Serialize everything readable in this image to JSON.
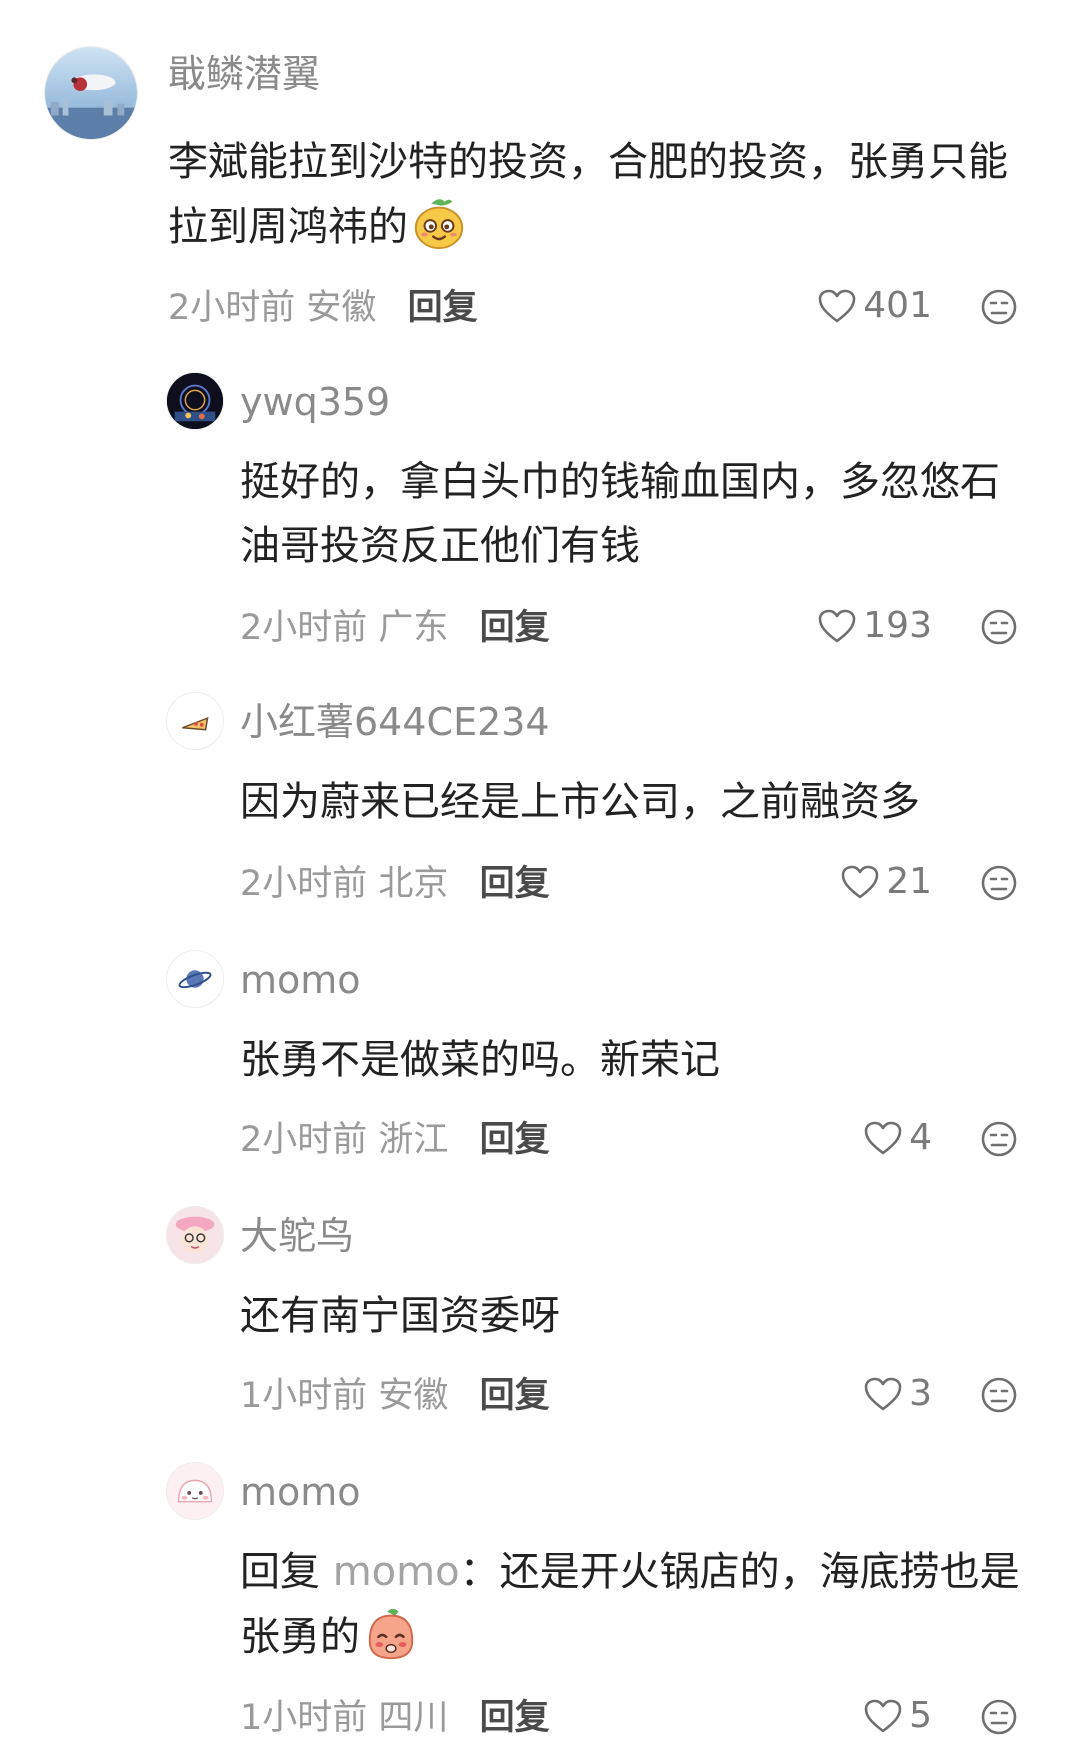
{
  "comments": [
    {
      "username": "戢鳞潜翼",
      "text_before_emoji": "李斌能拉到沙特的投资，合肥的投资，张勇只能拉到周鸿祎的",
      "emoji": "smirk-sticker",
      "time": "2小时前",
      "location": "安徽",
      "reply_label": "回复",
      "likes": "401"
    },
    {
      "username": "ywq359",
      "text_before_emoji": "挺好的，拿白头巾的钱输血国内，多忽悠石油哥投资反正他们有钱",
      "time": "2小时前",
      "location": "广东",
      "reply_label": "回复",
      "likes": "193"
    },
    {
      "username": "小红薯644CE234",
      "text_before_emoji": "因为蔚来已经是上市公司，之前融资多",
      "time": "2小时前",
      "location": "北京",
      "reply_label": "回复",
      "likes": "21"
    },
    {
      "username": "momo",
      "text_before_emoji": "张勇不是做菜的吗。新荣记",
      "time": "2小时前",
      "location": "浙江",
      "reply_label": "回复",
      "likes": "4"
    },
    {
      "username": "大鸵鸟",
      "text_before_emoji": "还有南宁国资委呀",
      "time": "1小时前",
      "location": "安徽",
      "reply_label": "回复",
      "likes": "3"
    },
    {
      "username": "momo",
      "reply_prefix": "回复",
      "reply_to": "momo",
      "reply_colon": "：",
      "text_before_emoji": "还是开火锅店的，海底捞也是张勇的",
      "emoji": "shy-sticker",
      "time": "1小时前",
      "location": "四川",
      "reply_label": "回复",
      "likes": "5"
    }
  ],
  "colors": {
    "username": "#8a8a8a",
    "text": "#222222",
    "meta": "#9a9a9a",
    "reply": "#4a4a4a"
  },
  "icons": {
    "like": "heart-outline-icon",
    "dislike": "meh-face-icon"
  }
}
